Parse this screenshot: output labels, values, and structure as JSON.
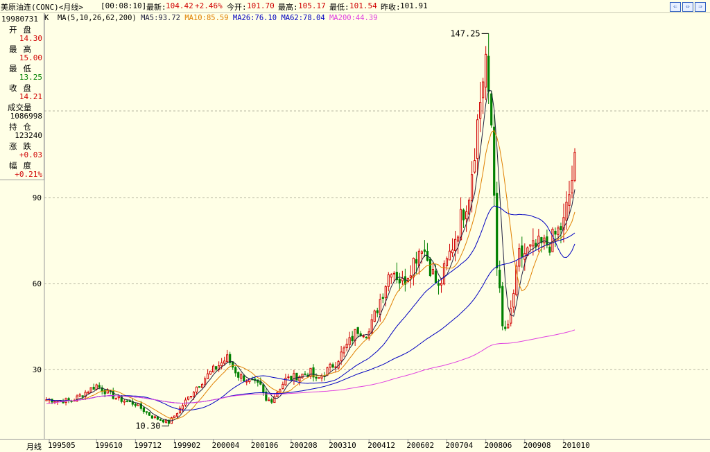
{
  "header": {
    "symbol": "美原油连(CONC)<月线>",
    "time": "[00:08:10]",
    "latest_label": "最新:",
    "latest_value": "104.42",
    "change_pct": "+2.46%",
    "open_label": "今开:",
    "open_value": "101.70",
    "high_label": "最高:",
    "high_value": "105.17",
    "low_label": "最低:",
    "low_value": "101.54",
    "prev_label": "昨收:",
    "prev_value": "101.91"
  },
  "ma_bar": {
    "k": "K",
    "params": "MA(5,10,26,62,200)",
    "ma5": "MA5:93.72",
    "ma10": "MA10:85.59",
    "ma26": "MA26:76.10",
    "ma62": "MA62:78.04",
    "ma200": "MA200:44.39"
  },
  "info": {
    "date": "19980731",
    "open_label": "开盘",
    "open": "14.30",
    "high_label": "最高",
    "high": "15.00",
    "low_label": "最低",
    "low": "13.25",
    "close_label": "收盘",
    "close": "14.21",
    "volume_label": "成交量",
    "volume": "1086998",
    "oi_label": "持仓",
    "oi": "123240",
    "chg_label": "涨跌",
    "chg": "+0.03",
    "pct_label": "幅度",
    "pct": "+0.21%"
  },
  "bottom": {
    "period_label": "月线"
  },
  "colors": {
    "up": "#d00000",
    "down": "#008000",
    "ma5": "#202040",
    "ma10": "#e08000",
    "ma26": "#0000c0",
    "ma62": "#0000c0",
    "ma200": "#e040e0",
    "grid": "#b4b4a0",
    "background": "#ffffe6"
  },
  "chart_data": {
    "type": "candlestick",
    "period": "monthly",
    "y_ticks": [
      30,
      60,
      90
    ],
    "ylim": [
      5,
      150
    ],
    "x_ticks": [
      "199505",
      "199610",
      "199712",
      "199902",
      "200004",
      "200106",
      "200208",
      "200310",
      "200412",
      "200602",
      "200704",
      "200806",
      "200908",
      "201010"
    ],
    "annotations": [
      {
        "text": "147.25",
        "x": "200807",
        "y": 147.25,
        "kind": "high"
      },
      {
        "text": "10.30",
        "x": "199812",
        "y": 10.3,
        "kind": "low"
      }
    ],
    "start": "199504",
    "end": "201102",
    "anchors": [
      [
        "199504",
        19.5
      ],
      [
        "199601",
        19.0
      ],
      [
        "199610",
        24.5
      ],
      [
        "199705",
        20.0
      ],
      [
        "199712",
        18.0
      ],
      [
        "199806",
        13.5
      ],
      [
        "199812",
        11.5
      ],
      [
        "199903",
        15.0
      ],
      [
        "199910",
        24.0
      ],
      [
        "200003",
        29.0
      ],
      [
        "200009",
        34.0
      ],
      [
        "200101",
        28.0
      ],
      [
        "200109",
        24.0
      ],
      [
        "200111",
        19.0
      ],
      [
        "200201",
        19.5
      ],
      [
        "200206",
        26.5
      ],
      [
        "200303",
        29.0
      ],
      [
        "200305",
        26.0
      ],
      [
        "200312",
        32.5
      ],
      [
        "200408",
        44.0
      ],
      [
        "200412",
        43.0
      ],
      [
        "200508",
        66.0
      ],
      [
        "200512",
        60.0
      ],
      [
        "200607",
        74.0
      ],
      [
        "200701",
        58.0
      ],
      [
        "200707",
        76.5
      ],
      [
        "200712",
        92.0
      ],
      [
        "200806",
        140.0
      ],
      [
        "200808",
        115.0
      ],
      [
        "200810",
        68.0
      ],
      [
        "200812",
        44.5
      ],
      [
        "200902",
        44.0
      ],
      [
        "200906",
        69.5
      ],
      [
        "201001",
        73.0
      ],
      [
        "201005",
        74.0
      ],
      [
        "201010",
        81.0
      ],
      [
        "201012",
        91.0
      ],
      [
        "201102",
        101.9
      ]
    ],
    "moving_averages": [
      {
        "name": "MA5",
        "period": 5,
        "value": 93.72
      },
      {
        "name": "MA10",
        "period": 10,
        "value": 85.59
      },
      {
        "name": "MA26",
        "period": 26,
        "value": 76.1
      },
      {
        "name": "MA62",
        "period": 62,
        "value": 78.04
      },
      {
        "name": "MA200",
        "period": 200,
        "value": 44.39
      }
    ]
  }
}
